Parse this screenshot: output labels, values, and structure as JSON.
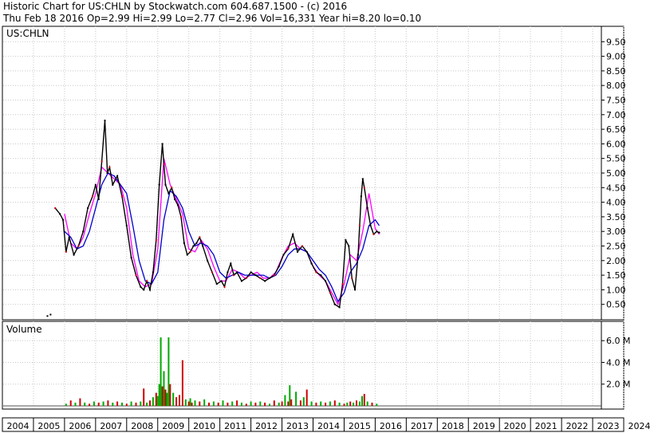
{
  "header": {
    "title": "Historic Chart for US:CHLN by Stockwatch.com 604.687.1500 - (c) 2016",
    "summary": "Thu Feb 18 2016  Op=2.99  Hi=2.99  Lo=2.77  Cl=2.96  Vol=16,331  Year hi=8.20  lo=0.10"
  },
  "chart_data": [
    {
      "type": "line",
      "panel": "price",
      "symbol_label": "US:CHLN",
      "x_unit": "year",
      "ylim": [
        0,
        10
      ],
      "y_ticks": [
        "9.50",
        "9.00",
        "8.50",
        "8.00",
        "7.50",
        "7.00",
        "6.50",
        "6.00",
        "5.50",
        "5.00",
        "4.50",
        "4.00",
        "3.50",
        "3.00",
        "2.50",
        "2.00",
        "1.50",
        "1.00",
        "0.50"
      ],
      "y_tick_values": [
        9.5,
        9.0,
        8.5,
        8.0,
        7.5,
        7.0,
        6.5,
        6.0,
        5.5,
        5.0,
        4.5,
        4.0,
        3.5,
        3.0,
        2.5,
        2.0,
        1.5,
        1.0,
        0.5
      ],
      "grid": true,
      "colors": {
        "price": "#000000",
        "ma_short": "#ff00ff",
        "ma_long": "#0000cc",
        "gain": "#00aa00",
        "loss": "#cc0000"
      },
      "series": [
        {
          "role": "price",
          "x": [
            2005.45,
            2005.55,
            2005.7,
            2005.85,
            2005.95,
            2006.05,
            2006.15,
            2006.3,
            2006.45,
            2006.6,
            2006.75,
            2006.9,
            2007.0,
            2007.1,
            2007.2,
            2007.3,
            2007.38,
            2007.45,
            2007.55,
            2007.7,
            2007.85,
            2008.0,
            2008.15,
            2008.3,
            2008.45,
            2008.55,
            2008.65,
            2008.75,
            2008.85,
            2008.95,
            2009.05,
            2009.15,
            2009.2,
            2009.25,
            2009.35,
            2009.45,
            2009.55,
            2009.65,
            2009.75,
            2009.85,
            2009.95,
            2010.05,
            2010.15,
            2010.25,
            2010.35,
            2010.45,
            2010.6,
            2010.75,
            2010.9,
            2011.05,
            2011.15,
            2011.25,
            2011.35,
            2011.45,
            2011.55,
            2011.7,
            2011.85,
            2012.0,
            2012.15,
            2012.3,
            2012.45,
            2012.6,
            2012.75,
            2012.9,
            2013.05,
            2013.2,
            2013.35,
            2013.5,
            2013.65,
            2013.8,
            2013.95,
            2014.1,
            2014.25,
            2014.4,
            2014.55,
            2014.7,
            2014.85,
            2014.95,
            2015.05,
            2015.15,
            2015.25,
            2015.35,
            2015.45,
            2015.5,
            2015.55,
            2015.6,
            2015.65,
            2015.75,
            2015.85,
            2015.95,
            2016.05,
            2016.13
          ],
          "values": [
            0.1,
            0.15,
            3.8,
            3.6,
            3.4,
            2.3,
            2.8,
            2.2,
            2.5,
            3.0,
            3.8,
            4.2,
            4.6,
            4.1,
            5.4,
            6.8,
            5.0,
            5.2,
            4.6,
            4.9,
            4.2,
            3.2,
            2.1,
            1.5,
            1.1,
            1.0,
            1.3,
            1.0,
            1.6,
            2.7,
            4.6,
            6.0,
            5.3,
            4.6,
            4.3,
            4.5,
            4.1,
            3.9,
            3.5,
            2.6,
            2.2,
            2.3,
            2.5,
            2.6,
            2.8,
            2.5,
            2.0,
            1.6,
            1.2,
            1.3,
            1.1,
            1.6,
            1.9,
            1.5,
            1.6,
            1.3,
            1.4,
            1.6,
            1.5,
            1.4,
            1.3,
            1.4,
            1.5,
            1.8,
            2.2,
            2.4,
            2.9,
            2.3,
            2.5,
            2.3,
            1.9,
            1.6,
            1.5,
            1.3,
            0.9,
            0.5,
            0.4,
            1.2,
            2.7,
            2.5,
            1.4,
            1.0,
            2.2,
            3.2,
            4.2,
            4.8,
            4.5,
            3.8,
            3.2,
            2.9,
            3.0,
            2.96
          ]
        },
        {
          "role": "ma_short",
          "x": [
            2006.0,
            2006.2,
            2006.4,
            2006.6,
            2006.8,
            2007.0,
            2007.2,
            2007.4,
            2007.6,
            2007.8,
            2008.0,
            2008.2,
            2008.4,
            2008.6,
            2008.8,
            2009.0,
            2009.2,
            2009.4,
            2009.6,
            2009.8,
            2010.0,
            2010.2,
            2010.4,
            2010.6,
            2010.8,
            2011.0,
            2011.2,
            2011.4,
            2011.6,
            2011.8,
            2012.0,
            2012.2,
            2012.4,
            2012.6,
            2012.8,
            2013.0,
            2013.2,
            2013.4,
            2013.6,
            2013.8,
            2014.0,
            2014.2,
            2014.4,
            2014.6,
            2014.8,
            2015.0,
            2015.2,
            2015.4,
            2015.6,
            2015.8,
            2016.0,
            2016.13
          ],
          "values": [
            3.6,
            2.6,
            2.4,
            2.8,
            3.6,
            4.3,
            5.2,
            5.0,
            4.8,
            4.6,
            3.8,
            2.2,
            1.3,
            1.1,
            1.2,
            2.4,
            5.5,
            4.6,
            4.1,
            3.6,
            2.4,
            2.3,
            2.7,
            2.4,
            1.8,
            1.3,
            1.3,
            1.7,
            1.6,
            1.4,
            1.5,
            1.6,
            1.4,
            1.4,
            1.6,
            2.1,
            2.5,
            2.6,
            2.4,
            2.3,
            1.8,
            1.5,
            1.3,
            0.9,
            0.5,
            1.2,
            2.2,
            2.0,
            3.0,
            4.3,
            3.1,
            2.9
          ]
        },
        {
          "role": "ma_long",
          "x": [
            2006.0,
            2006.2,
            2006.4,
            2006.6,
            2006.8,
            2007.0,
            2007.2,
            2007.4,
            2007.6,
            2007.8,
            2008.0,
            2008.2,
            2008.4,
            2008.6,
            2008.8,
            2009.0,
            2009.2,
            2009.4,
            2009.6,
            2009.8,
            2010.0,
            2010.2,
            2010.4,
            2010.6,
            2010.8,
            2011.0,
            2011.2,
            2011.4,
            2011.6,
            2011.8,
            2012.0,
            2012.2,
            2012.4,
            2012.6,
            2012.8,
            2013.0,
            2013.2,
            2013.4,
            2013.6,
            2013.8,
            2014.0,
            2014.2,
            2014.4,
            2014.6,
            2014.8,
            2015.0,
            2015.2,
            2015.4,
            2015.6,
            2015.8,
            2016.0,
            2016.13
          ],
          "values": [
            3.0,
            2.8,
            2.4,
            2.5,
            3.0,
            3.8,
            4.6,
            5.0,
            4.9,
            4.6,
            4.3,
            3.2,
            2.0,
            1.3,
            1.2,
            1.6,
            3.4,
            4.4,
            4.2,
            3.8,
            3.0,
            2.5,
            2.6,
            2.5,
            2.2,
            1.6,
            1.4,
            1.5,
            1.6,
            1.5,
            1.5,
            1.5,
            1.5,
            1.4,
            1.5,
            1.8,
            2.2,
            2.4,
            2.4,
            2.3,
            2.0,
            1.7,
            1.5,
            1.1,
            0.6,
            0.9,
            1.6,
            1.9,
            2.4,
            3.2,
            3.4,
            3.2
          ]
        }
      ]
    },
    {
      "type": "bar",
      "panel": "volume",
      "title": "Volume",
      "x_unit": "year",
      "y_unit": "millions of shares",
      "ylim": [
        0,
        7.7
      ],
      "y_ticks": [
        "6.0 M",
        "4.0 M",
        "2.0 M"
      ],
      "y_tick_values": [
        6,
        4,
        2
      ],
      "colors": {
        "gain": "#00aa00",
        "loss": "#cc0000",
        "baseline": "#555555"
      },
      "x": [
        2006.05,
        2006.2,
        2006.35,
        2006.5,
        2006.65,
        2006.8,
        2006.95,
        2007.1,
        2007.25,
        2007.4,
        2007.55,
        2007.7,
        2007.85,
        2008.0,
        2008.15,
        2008.3,
        2008.45,
        2008.55,
        2008.65,
        2008.75,
        2008.85,
        2008.95,
        2009.0,
        2009.05,
        2009.1,
        2009.15,
        2009.2,
        2009.25,
        2009.3,
        2009.35,
        2009.4,
        2009.5,
        2009.6,
        2009.7,
        2009.8,
        2009.9,
        2010.0,
        2010.05,
        2010.1,
        2010.2,
        2010.35,
        2010.5,
        2010.65,
        2010.8,
        2010.95,
        2011.1,
        2011.25,
        2011.4,
        2011.55,
        2011.7,
        2011.85,
        2012.0,
        2012.15,
        2012.3,
        2012.45,
        2012.6,
        2012.75,
        2012.9,
        2013.0,
        2013.1,
        2013.2,
        2013.25,
        2013.3,
        2013.45,
        2013.6,
        2013.7,
        2013.8,
        2013.95,
        2014.1,
        2014.25,
        2014.4,
        2014.55,
        2014.7,
        2014.85,
        2015.0,
        2015.1,
        2015.2,
        2015.3,
        2015.4,
        2015.5,
        2015.58,
        2015.65,
        2015.75,
        2015.9,
        2016.05
      ],
      "values": [
        0.2,
        0.5,
        0.3,
        0.7,
        0.3,
        0.2,
        0.4,
        0.3,
        0.4,
        0.5,
        0.3,
        0.4,
        0.3,
        0.2,
        0.4,
        0.3,
        0.4,
        1.6,
        0.3,
        0.5,
        0.8,
        1.2,
        0.9,
        2.0,
        6.3,
        1.8,
        3.2,
        1.5,
        1.2,
        6.3,
        2.0,
        1.2,
        0.8,
        1.0,
        4.2,
        0.6,
        0.4,
        0.7,
        0.3,
        0.5,
        0.4,
        0.6,
        0.3,
        0.4,
        0.3,
        0.5,
        0.3,
        0.4,
        0.5,
        0.3,
        0.2,
        0.4,
        0.3,
        0.4,
        0.3,
        0.2,
        0.5,
        0.3,
        0.4,
        1.0,
        0.4,
        1.9,
        0.6,
        1.3,
        0.5,
        0.8,
        1.5,
        0.4,
        0.3,
        0.4,
        0.3,
        0.4,
        0.5,
        0.3,
        0.2,
        0.3,
        0.4,
        0.3,
        0.5,
        0.4,
        0.9,
        1.1,
        0.4,
        0.3,
        0.2
      ],
      "direction": [
        "up",
        "down",
        "up",
        "down",
        "up",
        "down",
        "up",
        "down",
        "up",
        "down",
        "up",
        "down",
        "up",
        "down",
        "up",
        "down",
        "up",
        "down",
        "up",
        "down",
        "up",
        "down",
        "up",
        "up",
        "up",
        "down",
        "up",
        "down",
        "up",
        "up",
        "down",
        "up",
        "down",
        "down",
        "down",
        "up",
        "down",
        "up",
        "down",
        "up",
        "down",
        "up",
        "down",
        "up",
        "down",
        "up",
        "down",
        "up",
        "down",
        "up",
        "down",
        "up",
        "down",
        "up",
        "down",
        "up",
        "down",
        "up",
        "down",
        "up",
        "down",
        "up",
        "down",
        "up",
        "down",
        "up",
        "down",
        "up",
        "down",
        "up",
        "down",
        "up",
        "down",
        "up",
        "down",
        "up",
        "down",
        "up",
        "down",
        "up",
        "up",
        "down",
        "up",
        "down",
        "up"
      ]
    },
    {
      "type": "axis",
      "panel": "time_axis",
      "x_ticks": [
        "2004",
        "2005",
        "2006",
        "2007",
        "2008",
        "2009",
        "2010",
        "2011",
        "2012",
        "2013",
        "2014",
        "2015",
        "2016",
        "2017",
        "2018",
        "2019",
        "2020",
        "2021",
        "2022",
        "2023",
        "2024"
      ]
    }
  ]
}
